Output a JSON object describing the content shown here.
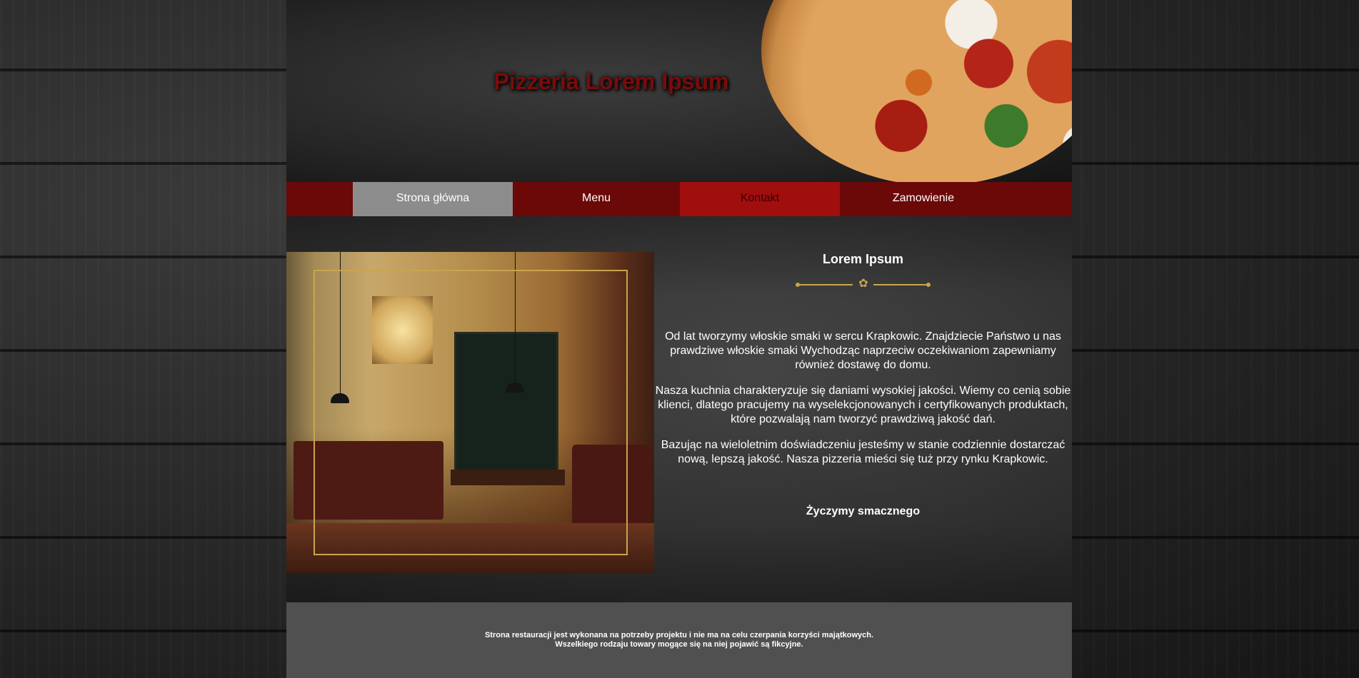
{
  "header": {
    "title": "Pizzeria Lorem Ipsum"
  },
  "nav": {
    "items": [
      {
        "label": "Strona główna"
      },
      {
        "label": "Menu"
      },
      {
        "label": "Kontakt"
      },
      {
        "label": "Zamowienie"
      }
    ],
    "active_index": 0
  },
  "main": {
    "heading": "Lorem Ipsum",
    "paragraphs": [
      "Od lat tworzymy włoskie smaki w sercu Krapkowic. Znajdziecie Państwo u nas prawdziwe włoskie smaki Wychodząc naprzeciw oczekiwaniom zapewniamy również dostawę do domu.",
      "Nasza kuchnia charakteryzuje się daniami wysokiej jakości. Wiemy co cenią sobie klienci, dlatego pracujemy na wyselekcjonowanych i certyfikowanych produktach, które pozwalają nam tworzyć prawdziwą jakość dań.",
      "Bazując na wieloletnim doświadczeniu jesteśmy w stanie codziennie dostarczać nową, lepszą jakość. Nasza pizzeria mieści się tuż przy rynku Krapkowic."
    ],
    "closing": "Życzymy smacznego"
  },
  "footer": {
    "line1": "Strona restauracji jest wykonana na potrzeby projektu i nie ma na celu czerpania korzyści majątkowych.",
    "line2": "Wszelkiego rodzaju towary mogące się na niej pojawić są fikcyjne."
  },
  "colors": {
    "nav_background": "#6b0909",
    "nav_active": "#8c8c8c",
    "nav_highlight": "#a10e0e",
    "title_color": "#7b0b0b",
    "ornament_gold": "#c9a44f",
    "footer_background": "#505050"
  },
  "icons": {
    "divider_ornament": "flower-ornament-icon"
  }
}
